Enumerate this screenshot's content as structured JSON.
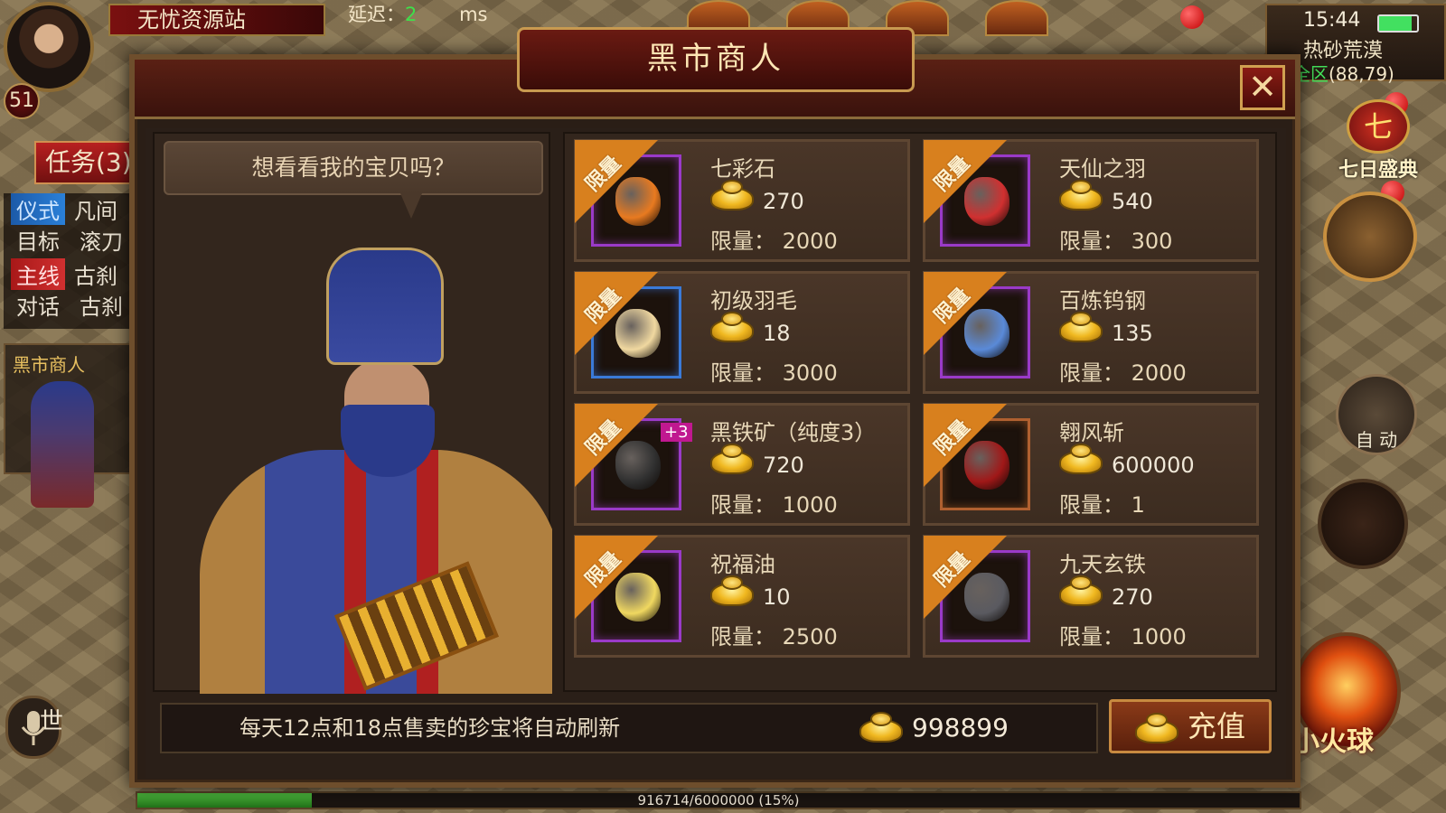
{
  "hud": {
    "player_level": "51",
    "resource_site": "无忧资源站",
    "latency_label": "延迟：",
    "latency_value": "2",
    "latency_unit": "ms",
    "task_button": "任务(3)",
    "quests": [
      {
        "tag": "仪式",
        "text": "凡间"
      },
      {
        "tag": "目标",
        "text": "滚刀"
      },
      {
        "tag": "主线",
        "text": "古刹"
      },
      {
        "tag": "对话",
        "text": "古刹"
      }
    ],
    "npc_label": "黑市商人",
    "mic_world": "世",
    "clock": "15:44",
    "battery_level": 0.86,
    "map_name": "热砂荒漠",
    "map_zone": "全区",
    "map_coord": "(88,79)",
    "seven_day_icon": "七",
    "seven_day_label": "七日盛典",
    "auto_label": "自 动",
    "fireball_label": "小火球",
    "exp_text": "916714/6000000 (15%)",
    "exp_fraction": 0.15
  },
  "shop": {
    "title": "黑市商人",
    "close_icon": "close-icon",
    "speech": "想看看我的宝贝吗？",
    "ribbon_label": "限量",
    "limit_label": "限量：",
    "items": [
      {
        "name": "七彩石",
        "price": "270",
        "limit": "2000",
        "slot": "purple",
        "gem_color": "#e87a20"
      },
      {
        "name": "天仙之羽",
        "price": "540",
        "limit": "300",
        "slot": "purple",
        "gem_color": "#d03030"
      },
      {
        "name": "初级羽毛",
        "price": "18",
        "limit": "3000",
        "slot": "blue",
        "gem_color": "#f0d8a0"
      },
      {
        "name": "百炼钨钢",
        "price": "135",
        "limit": "2000",
        "slot": "purple",
        "gem_color": "#5a8ad8"
      },
      {
        "name": "黑铁矿（纯度3）",
        "price": "720",
        "limit": "1000",
        "slot": "purple",
        "gem_color": "#303030",
        "badge": "+3"
      },
      {
        "name": "翱风斩",
        "price": "600000",
        "limit": "1",
        "slot": "brown",
        "gem_color": "#a01818"
      },
      {
        "name": "祝福油",
        "price": "10",
        "limit": "2500",
        "slot": "purple",
        "gem_color": "#f0d860"
      },
      {
        "name": "九天玄铁",
        "price": "270",
        "limit": "1000",
        "slot": "purple",
        "gem_color": "#5a5a60"
      }
    ],
    "refresh_note": "每天12点和18点售卖的珍宝将自动刷新",
    "balance": "998899",
    "recharge_label": "充值"
  },
  "colors": {
    "accent_gold": "#f0b820",
    "ribbon": "#d8801e",
    "slot_purple": "#9a3ac8",
    "slot_blue": "#3a7ad8",
    "zone_green": "#44e05a"
  }
}
